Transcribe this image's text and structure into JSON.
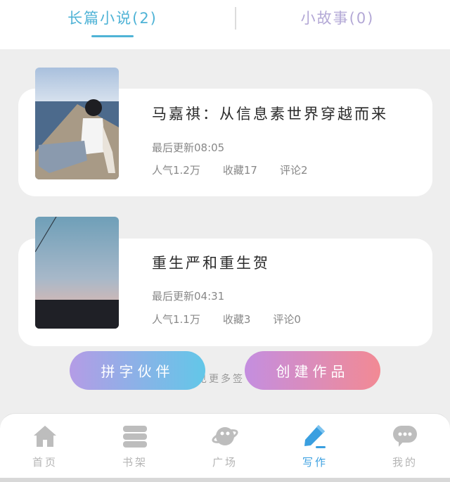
{
  "tabs": [
    {
      "label": "长篇小说(2)",
      "active": true
    },
    {
      "label": "小故事(0)",
      "active": false
    }
  ],
  "novels": [
    {
      "title": "马嘉祺：从信息素世界穿越而来",
      "updated": "最后更新08:05",
      "popularity": "人气1.2万",
      "favorites": "收藏17",
      "comments": "评论2"
    },
    {
      "title": "重生严和重生贺",
      "updated": "最后更新04:31",
      "popularity": "人气1.1万",
      "favorites": "收藏3",
      "comments": "评论0"
    }
  ],
  "hint_text": "见更多签",
  "buttons": {
    "partner": "拼字伙伴",
    "create": "创建作品"
  },
  "nav": [
    {
      "label": "首页",
      "icon": "home-icon",
      "active": false
    },
    {
      "label": "书架",
      "icon": "bookshelf-icon",
      "active": false
    },
    {
      "label": "广场",
      "icon": "planet-icon",
      "active": false
    },
    {
      "label": "写作",
      "icon": "pen-icon",
      "active": true
    },
    {
      "label": "我的",
      "icon": "chat-bubble-icon",
      "active": false
    }
  ],
  "colors": {
    "accent": "#4fb3d6",
    "nav_active": "#3a9fe0",
    "nav_inactive": "#b5b5b5"
  }
}
